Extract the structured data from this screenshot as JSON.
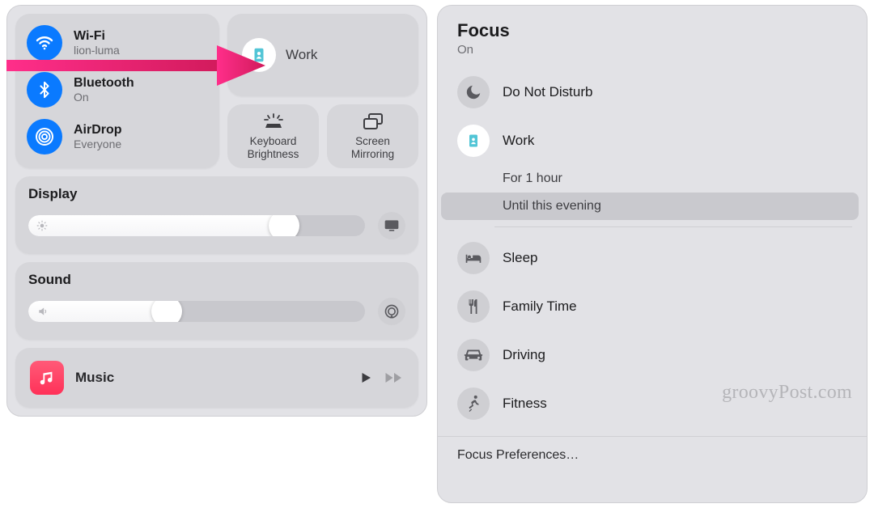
{
  "cc": {
    "conn": {
      "wifi": {
        "title": "Wi-Fi",
        "sub": "lion-luma"
      },
      "bluetooth": {
        "title": "Bluetooth",
        "sub": "On"
      },
      "airdrop": {
        "title": "AirDrop",
        "sub": "Everyone"
      }
    },
    "focus_tile": {
      "label": "Work"
    },
    "mini": {
      "keyboard": "Keyboard\nBrightness",
      "mirror": "Screen\nMirroring"
    },
    "display": {
      "title": "Display",
      "value_pct": 76
    },
    "sound": {
      "title": "Sound",
      "value_pct": 41
    },
    "music": {
      "label": "Music"
    }
  },
  "focus": {
    "title": "Focus",
    "status": "On",
    "items": {
      "dnd": "Do Not Disturb",
      "work": "Work",
      "sleep": "Sleep",
      "family": "Family Time",
      "driving": "Driving",
      "fitness": "Fitness"
    },
    "work_opts": {
      "one_hour": "For 1 hour",
      "evening": "Until this evening"
    },
    "footer": "Focus Preferences…"
  },
  "watermark": "groovyPost.com"
}
